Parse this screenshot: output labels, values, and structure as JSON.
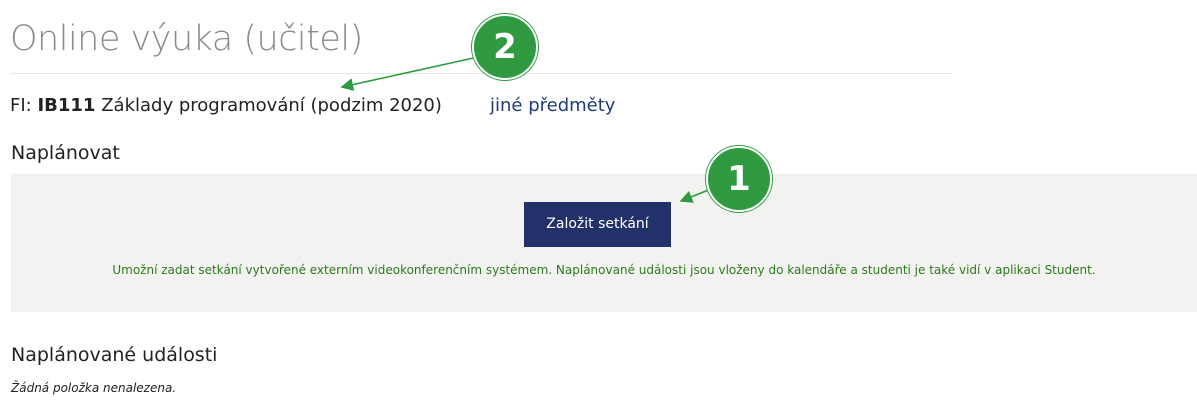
{
  "page": {
    "title": "Online výuka (učitel)"
  },
  "course": {
    "prefix": "FI:",
    "code": "IB111",
    "name": "Základy programování (podzim 2020)",
    "other_subjects_link": "jiné předměty"
  },
  "plan": {
    "heading": "Naplánovat",
    "create_button_label": "Založit setkání",
    "help_text": "Umožní zadat setkání vytvořené externím videokonferenčním systémem. Naplánované události jsou vloženy do kalendáře a studenti je také vidí v aplikaci Student."
  },
  "events": {
    "heading": "Naplánované události",
    "empty_text": "Žádná položka nenalezena."
  },
  "annotations": {
    "badge_1": "1",
    "badge_2": "2"
  },
  "colors": {
    "accent_green": "#2f9a3f",
    "button_navy": "#23316a",
    "link_blue": "#1f3c7a",
    "help_text_green": "#2d7a1f",
    "panel_background": "#f2f2f0"
  }
}
